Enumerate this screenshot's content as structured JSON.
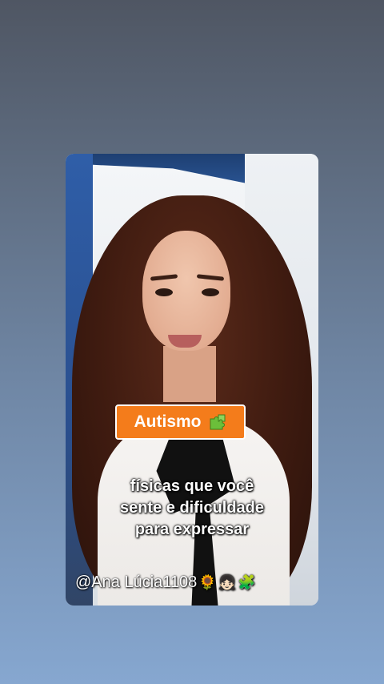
{
  "story": {
    "tag": {
      "label": "Autismo",
      "icon": "puzzle-icon",
      "color": "#f47c1b"
    },
    "caption": {
      "lines": [
        "físicas que você",
        "sente e dificuldade",
        "para expressar"
      ]
    },
    "handle": {
      "text": "@Ana Lúcia1108",
      "emojis": [
        "🌻",
        "👧🏻",
        "🧩"
      ]
    }
  }
}
